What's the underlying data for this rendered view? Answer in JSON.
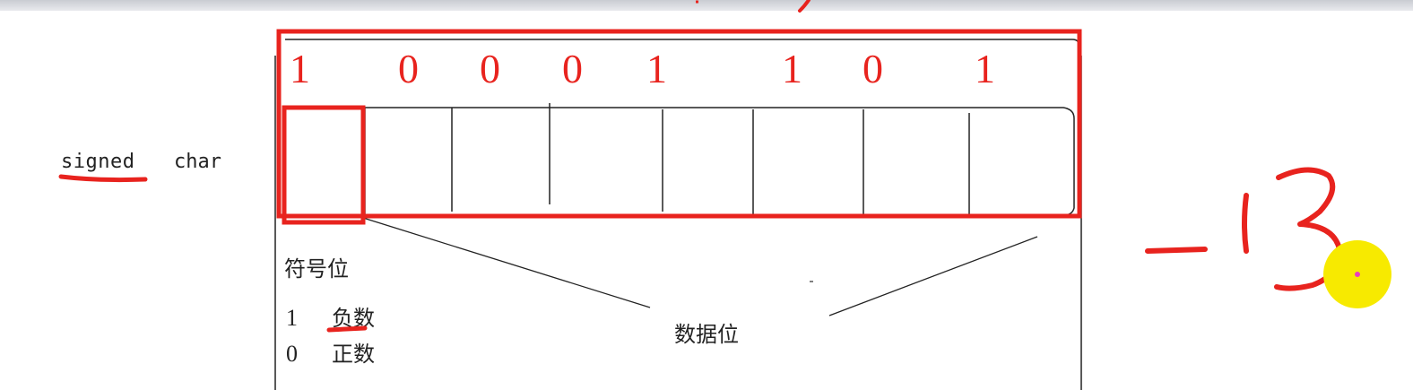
{
  "type_label": {
    "signed": "signed",
    "char": "char"
  },
  "bits": [
    "1",
    "0",
    "0",
    "0",
    "1",
    "1",
    "0",
    "1"
  ],
  "sign_bit": {
    "title": "符号位",
    "negative": {
      "value": "1",
      "text": "负数"
    },
    "positive": {
      "value": "0",
      "text": "正数"
    }
  },
  "data_bits_label": "数据位",
  "handwritten_value": "-13",
  "colors": {
    "annotation": "#e8231e",
    "pointer": "#f7ea00",
    "text": "#222222"
  }
}
